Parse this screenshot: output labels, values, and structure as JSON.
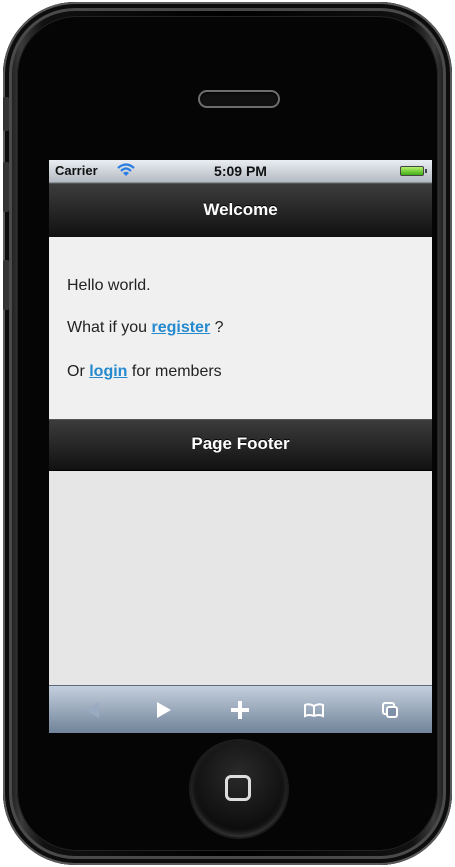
{
  "status_bar": {
    "carrier": "Carrier",
    "time": "5:09 PM",
    "wifi_icon": "wifi-icon",
    "battery_icon": "battery-icon"
  },
  "header": {
    "title": "Welcome"
  },
  "content": {
    "greeting": "Hello world.",
    "register_prefix": "What if you ",
    "register_link": "register",
    "register_suffix": " ?",
    "login_prefix": "Or ",
    "login_link": "login",
    "login_suffix": " for members"
  },
  "footer": {
    "title": "Page Footer"
  },
  "toolbar": {
    "items": [
      "back-icon",
      "forward-icon",
      "add-icon",
      "bookmarks-icon",
      "pages-icon"
    ]
  },
  "colors": {
    "link": "#2489ce",
    "bar": "#1e1e1e",
    "content_bg": "#f0f0f0",
    "screen_bg": "#e6e6e6"
  }
}
